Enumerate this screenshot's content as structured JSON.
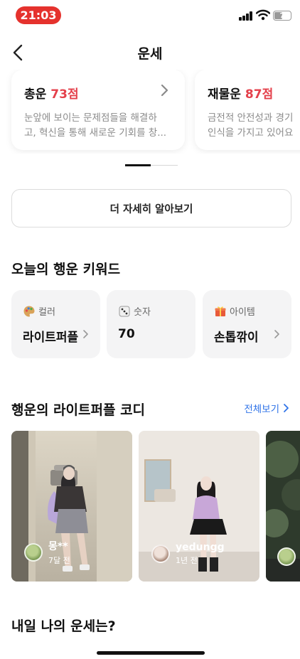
{
  "status_bar": {
    "time": "21:03",
    "battery": "7"
  },
  "header": {
    "title": "운세"
  },
  "fortune_cards": [
    {
      "title": "총운",
      "score": "73점",
      "desc_line1": "눈앞에 보이는 문제점들을 해결하",
      "desc_line2": "고, 혁신을 통해 새로운 기회를 창..."
    },
    {
      "title": "재물운",
      "score": "87점",
      "desc_line1": "금전적 안전성과 경기",
      "desc_line2": "인식을 가지고 있어요"
    }
  ],
  "pager": {
    "total": 2,
    "active": 1
  },
  "more_button": {
    "label": "더 자세히 알아보기"
  },
  "keywords": {
    "title": "오늘의 행운 키워드",
    "items": [
      {
        "icon": "palette-icon",
        "label": "컬러",
        "value": "라이트퍼플"
      },
      {
        "icon": "dice-icon",
        "label": "숫자",
        "value": "70"
      },
      {
        "icon": "gift-icon",
        "label": "아이템",
        "value": "손톱깎이"
      }
    ]
  },
  "coordi": {
    "title": "행운의 라이트퍼플 코디",
    "see_all": "전체보기",
    "items": [
      {
        "user": "몽**",
        "date": "7달 전"
      },
      {
        "user": "yedungg",
        "date": "1년 전"
      },
      {
        "user": "",
        "date": ""
      }
    ]
  },
  "tomorrow": {
    "title": "내일 나의 운세는?"
  },
  "colors": {
    "accent_red": "#e4404b",
    "link_blue": "#2f73e8",
    "status_red": "#e5322d"
  }
}
